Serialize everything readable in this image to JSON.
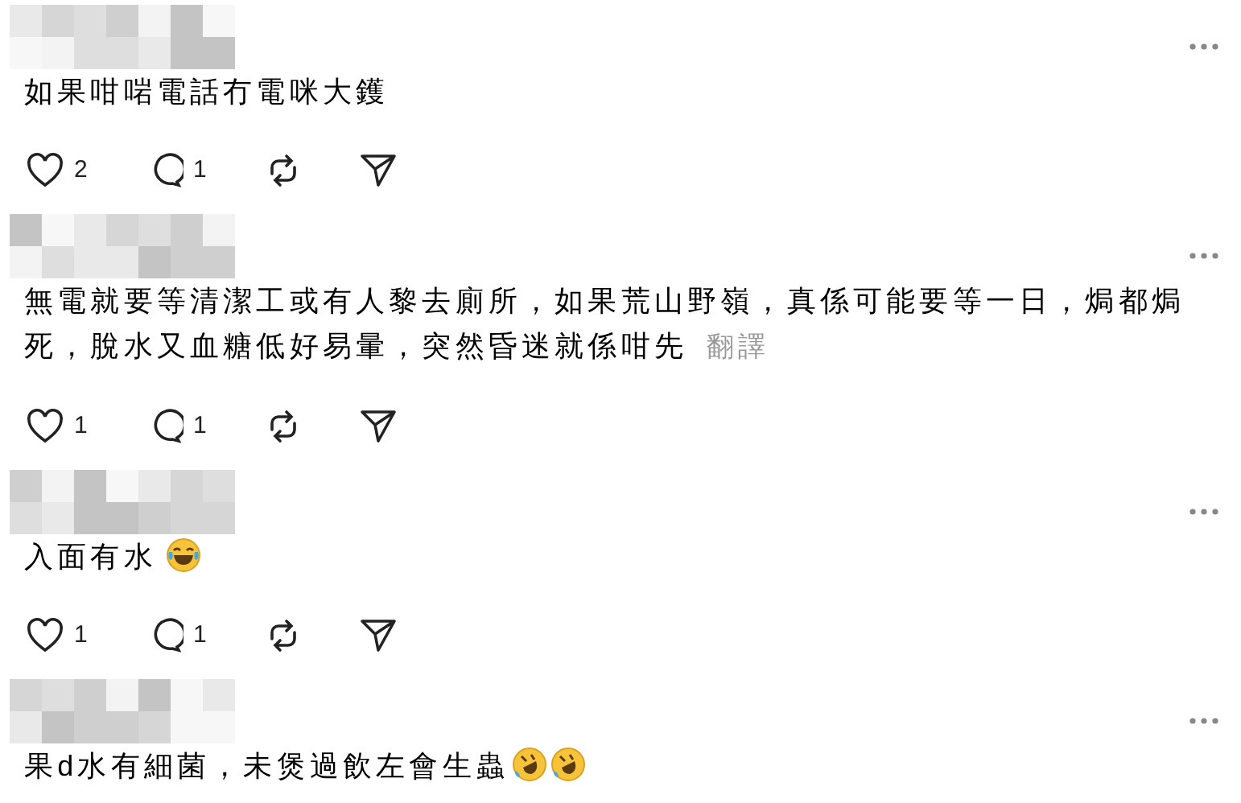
{
  "comments": [
    {
      "text": "如果咁啱電話冇電咪大鑊",
      "likes": "2",
      "replies": "1"
    },
    {
      "text": "無電就要等清潔工或有人黎去廁所，如果荒山野嶺，真係可能要等一日，焗都焗死，脫水又血糖低好易暈，突然昏迷就係咁先",
      "translate": "翻譯",
      "likes": "1",
      "replies": "1"
    },
    {
      "text": "入面有水",
      "emojis": [
        {
          "kind": "tears-of-joy"
        }
      ],
      "likes": "1",
      "replies": "1"
    },
    {
      "text": "果d水有細菌，未煲過飲左會生蟲",
      "emojis": [
        {
          "kind": "rolling-laugh"
        },
        {
          "kind": "rolling-laugh"
        }
      ]
    }
  ]
}
